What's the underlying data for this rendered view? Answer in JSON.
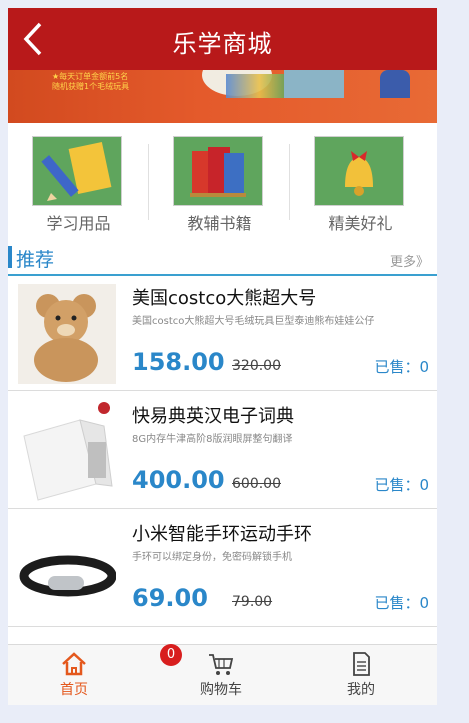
{
  "header": {
    "title": "乐学商城"
  },
  "banner": {
    "ad_text_1": "★每天订单金额前5名",
    "ad_text_2": "随机获赠1个毛绒玩具"
  },
  "categories": [
    {
      "label": "学习用品",
      "icon": "pencil-icon"
    },
    {
      "label": "教辅书籍",
      "icon": "books-icon"
    },
    {
      "label": "精美好礼",
      "icon": "bell-gift-icon"
    }
  ],
  "recommend": {
    "title": "推荐",
    "more": "更多》"
  },
  "products": [
    {
      "name": "美国costco大熊超大号",
      "desc": "美国costco大熊超大号毛绒玩具巨型泰迪熊布娃娃公仔",
      "price": "158.00",
      "old_price": "320.00",
      "sold": "已售：0",
      "image": "teddy-bear"
    },
    {
      "name": "快易典英汉电子词典",
      "desc": "8G内存牛津高阶8版润眼屏整句翻译",
      "price": "400.00",
      "old_price": "600.00",
      "sold": "已售：0",
      "image": "electronic-dictionary"
    },
    {
      "name": "小米智能手环运动手环",
      "desc": "手环可以绑定身份，免密码解锁手机",
      "price": "69.00",
      "old_price": "79.00",
      "sold": "已售：0",
      "image": "fitness-band"
    }
  ],
  "tabbar": {
    "items": [
      {
        "label": "首页",
        "icon": "home-icon",
        "active": true
      },
      {
        "label": "购物车",
        "icon": "cart-icon",
        "badge": "0"
      },
      {
        "label": "我的",
        "icon": "document-icon"
      }
    ]
  },
  "colors": {
    "header": "#b8191a",
    "accent": "#2a87c9",
    "active_tab": "#e4581d",
    "badge": "#d81e1e"
  }
}
